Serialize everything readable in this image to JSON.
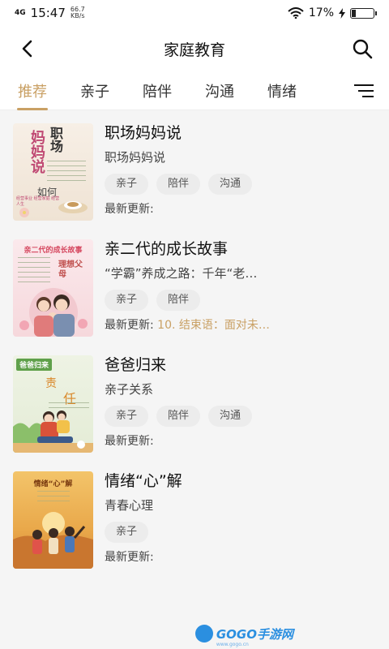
{
  "status": {
    "network": "4G",
    "time": "15:47",
    "speed_value": "66.7",
    "speed_unit": "KB/s",
    "battery": "17%",
    "battery_level": 0.17
  },
  "nav": {
    "title": "家庭教育",
    "back_icon": "back-arrow-icon",
    "search_icon": "search-icon"
  },
  "tabs": [
    {
      "label": "推荐",
      "active": true
    },
    {
      "label": "亲子",
      "active": false
    },
    {
      "label": "陪伴",
      "active": false
    },
    {
      "label": "沟通",
      "active": false
    },
    {
      "label": "情绪",
      "active": false
    }
  ],
  "items": [
    {
      "title": "职场妈妈说",
      "subtitle": "职场妈妈说",
      "tags": [
        "亲子",
        "陪伴",
        "沟通"
      ],
      "update_label": "最新更新:",
      "update_value": "",
      "cover_text_a": "妈妈说",
      "cover_text_b": "职场",
      "cover_text_c": "如何",
      "cover_text_d": "经营事业 经营家庭 经营人生"
    },
    {
      "title": "亲二代的成长故事",
      "subtitle": "“学霸”养成之路：千年“老…",
      "tags": [
        "亲子",
        "陪伴"
      ],
      "update_label": "最新更新:",
      "update_value": "10. 结束语：面对未…",
      "cover_text_a": "亲二代的成长故事",
      "cover_text_b": "理想父母"
    },
    {
      "title": "爸爸归来",
      "subtitle": "亲子关系",
      "tags": [
        "亲子",
        "陪伴",
        "沟通"
      ],
      "update_label": "最新更新:",
      "update_value": "",
      "cover_text_a": "爸爸归来",
      "cover_text_b": "责",
      "cover_text_c": "任"
    },
    {
      "title": "情绪“心”解",
      "subtitle": "青春心理",
      "tags": [
        "亲子"
      ],
      "update_label": "最新更新:",
      "update_value": "",
      "cover_text_a": "情绪“心”解"
    }
  ],
  "watermark": {
    "brand": "GOGO手游网",
    "url": "www.gogo.cn"
  },
  "colors": {
    "accent": "#c9a064",
    "tag_bg": "#ececec"
  }
}
